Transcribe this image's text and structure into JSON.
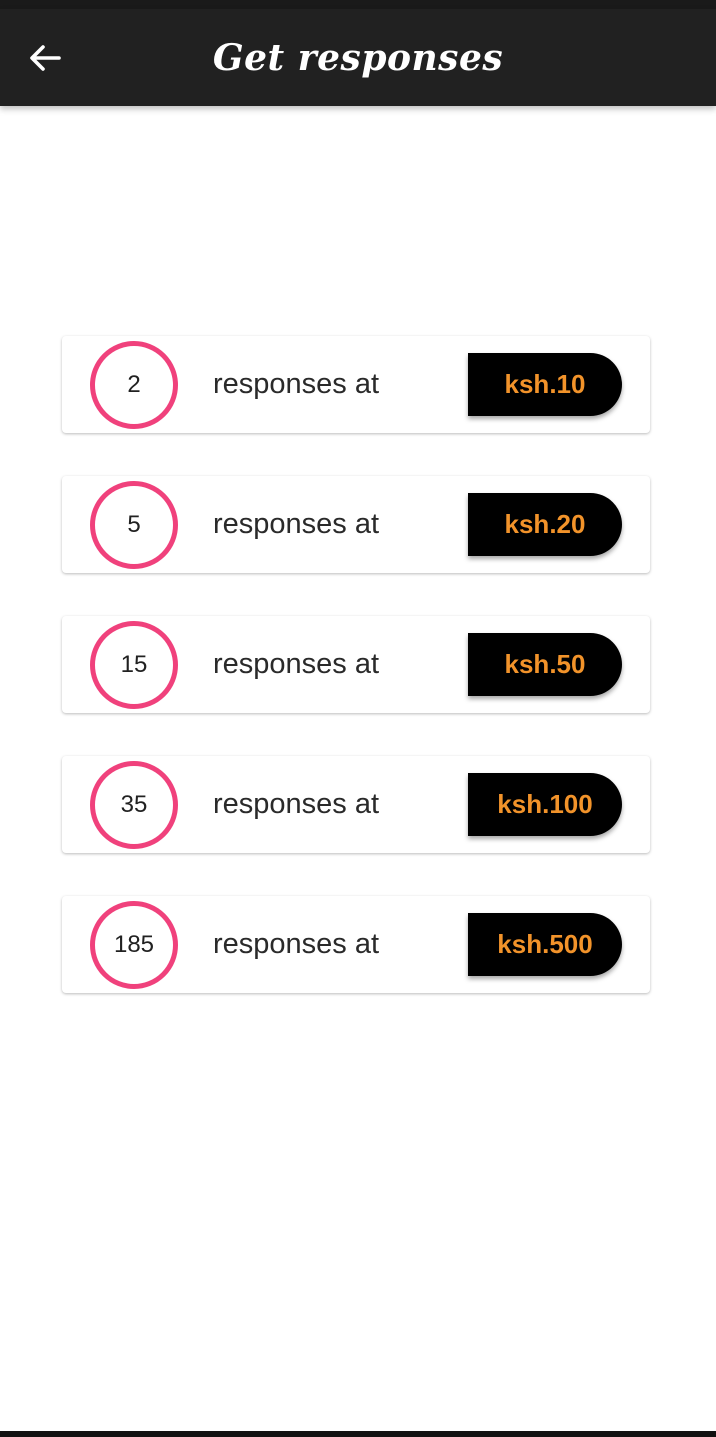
{
  "app_bar": {
    "title": "Get responses",
    "back_icon": "arrow-left-icon",
    "background_color": "#212121",
    "title_color": "#ffffff"
  },
  "offers": [
    {
      "count": "2",
      "label": "responses at",
      "price": "ksh.10"
    },
    {
      "count": "5",
      "label": "responses at",
      "price": "ksh.20"
    },
    {
      "count": "15",
      "label": "responses at",
      "price": "ksh.50"
    },
    {
      "count": "35",
      "label": "responses at",
      "price": "ksh.100"
    },
    {
      "count": "185",
      "label": "responses at",
      "price": "ksh.500"
    }
  ],
  "colors": {
    "ring": "#f0417c",
    "price_text": "#f2932a",
    "price_button": "#000000"
  }
}
